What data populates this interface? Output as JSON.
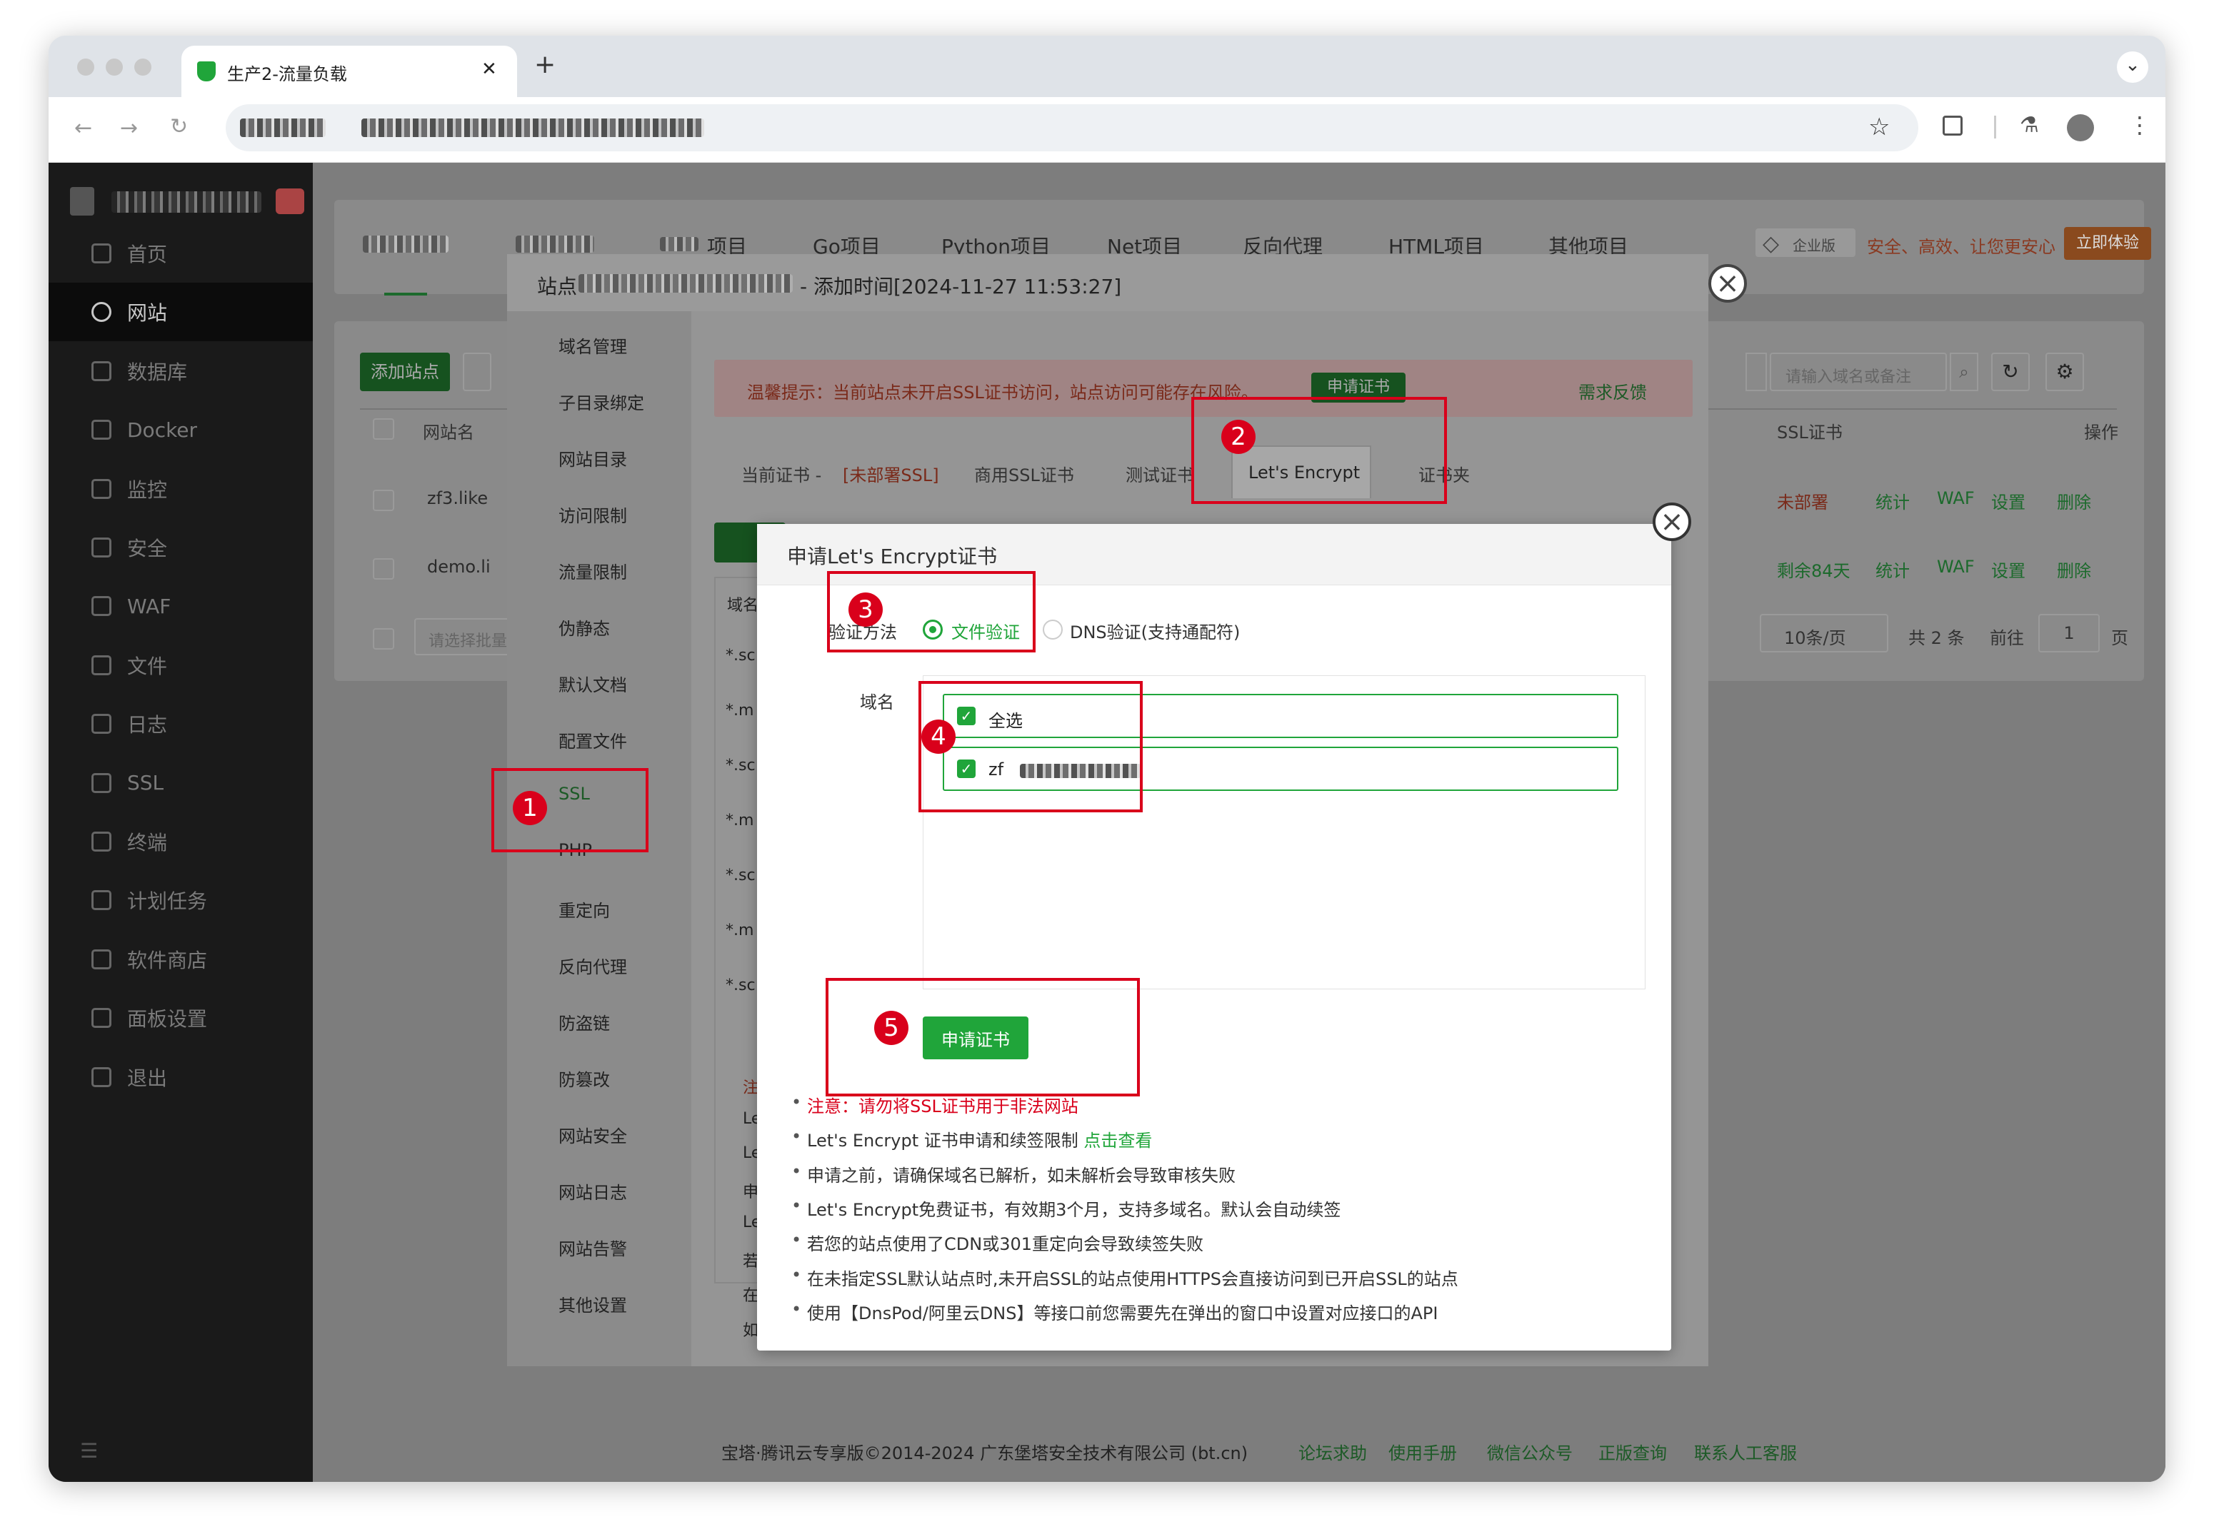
{
  "browser": {
    "tab_title": "生产2-流量负载",
    "tab_close": "✕",
    "new_tab": "+",
    "tab_menu": "⌄"
  },
  "sidebar": {
    "items": [
      {
        "label": "首页",
        "icon": "home-icon"
      },
      {
        "label": "网站",
        "icon": "globe-icon",
        "active": true
      },
      {
        "label": "数据库",
        "icon": "database-icon"
      },
      {
        "label": "Docker",
        "icon": "docker-icon"
      },
      {
        "label": "监控",
        "icon": "monitor-icon"
      },
      {
        "label": "安全",
        "icon": "shield-icon"
      },
      {
        "label": "WAF",
        "icon": "waf-icon"
      },
      {
        "label": "文件",
        "icon": "folder-icon"
      },
      {
        "label": "日志",
        "icon": "log-icon"
      },
      {
        "label": "SSL",
        "icon": "ssl-icon"
      },
      {
        "label": "终端",
        "icon": "terminal-icon"
      },
      {
        "label": "计划任务",
        "icon": "task-icon"
      },
      {
        "label": "软件商店",
        "icon": "store-icon"
      },
      {
        "label": "面板设置",
        "icon": "settings-icon"
      },
      {
        "label": "退出",
        "icon": "logout-icon"
      }
    ]
  },
  "topnav": {
    "items": [
      "项目",
      "Go项目",
      "Python项目",
      "Net项目",
      "反向代理",
      "HTML项目",
      "其他项目"
    ],
    "enterprise": "企业版",
    "promo": "安全、高效、让您更安心",
    "try_btn": "立即体验"
  },
  "site_toolbar": {
    "add_site": "添加站点",
    "search_placeholder": "请输入域名或备注"
  },
  "table": {
    "col_name": "网站名",
    "col_ssl": "SSL证书",
    "col_ops": "操作",
    "rows": [
      {
        "name": "zf3.like",
        "ssl": "未部署"
      },
      {
        "name": "demo.li",
        "ssl": "剩余84天"
      }
    ],
    "ops": [
      "统计",
      "WAF",
      "设置",
      "删除"
    ],
    "batch_placeholder": "请选择批量",
    "pagination": {
      "per_page": "10条/页",
      "total": "共 2 条",
      "goto": "前往",
      "page": "1",
      "page_unit": "页"
    }
  },
  "site_modal": {
    "title_prefix": "站点",
    "title_suffix": "- 添加时间[2024-11-27 11:53:27]",
    "menu": [
      "域名管理",
      "子目录绑定",
      "网站目录",
      "访问限制",
      "流量限制",
      "伪静态",
      "默认文档",
      "配置文件",
      "SSL",
      "PHP",
      "重定向",
      "反向代理",
      "防盗链",
      "防篡改",
      "网站安全",
      "网站日志",
      "网站告警",
      "其他设置"
    ],
    "warning": "温馨提示：当前站点未开启SSL证书访问，站点访问可能存在风险。",
    "apply_btn": "申请证书",
    "feedback": "需求反馈",
    "tabs": [
      "当前证书 -",
      "[未部署SSL]",
      "商用SSL证书",
      "测试证书",
      "Let's Encrypt",
      "证书夹"
    ],
    "col_domain": "域名",
    "rows": [
      "*.sc",
      "*.m",
      "*.sc",
      "*.m",
      "*.sc",
      "*.m",
      "*.sc"
    ],
    "bg_notes": [
      "注",
      "Le",
      "Le",
      "申",
      "Le",
      "若",
      "在",
      "如"
    ]
  },
  "dialog": {
    "title": "申请Let's Encrypt证书",
    "verify_label": "验证方法",
    "verify_file": "文件验证",
    "verify_dns": "DNS验证(支持通配符)",
    "domain_label": "域名",
    "select_all": "全选",
    "domain_item": "zf",
    "submit": "申请证书",
    "notes": [
      {
        "text": "注意：请勿将SSL证书用于非法网站",
        "warn": true
      },
      {
        "text": "Let's Encrypt 证书申请和续签限制 ",
        "link": "点击查看"
      },
      {
        "text": "申请之前，请确保域名已解析，如未解析会导致审核失败"
      },
      {
        "text": "Let's Encrypt免费证书，有效期3个月，支持多域名。默认会自动续签"
      },
      {
        "text": "若您的站点使用了CDN或301重定向会导致续签失败"
      },
      {
        "text": "在未指定SSL默认站点时,未开启SSL的站点使用HTTPS会直接访问到已开启SSL的站点"
      },
      {
        "text": "使用【DnsPod/阿里云DNS】等接口前您需要先在弹出的窗口中设置对应接口的API"
      }
    ]
  },
  "annotations": [
    "1",
    "2",
    "3",
    "4",
    "5"
  ],
  "footer": {
    "copyright": "宝塔·腾讯云专享版©2014-2024 广东堡塔安全技术有限公司 (bt.cn)",
    "links": [
      "论坛求助",
      "使用手册",
      "微信公众号",
      "正版查询",
      "联系人工客服"
    ]
  },
  "colors": {
    "accent": "#20a53a",
    "warn": "#d9001b",
    "annotation": "#d9001b"
  }
}
